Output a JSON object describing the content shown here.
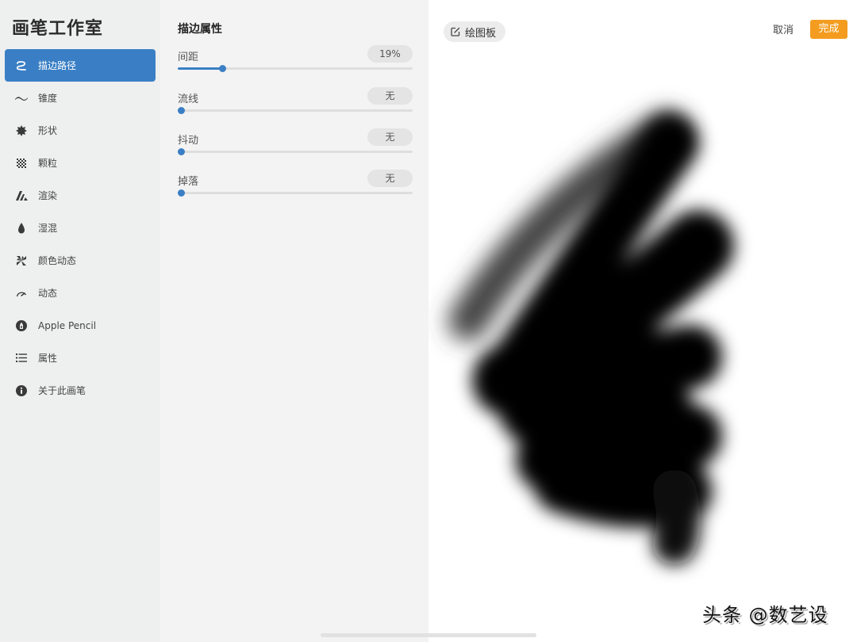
{
  "sidebar": {
    "title": "画笔工作室",
    "items": [
      {
        "label": "描边路径",
        "icon": "stroke-path-icon",
        "active": true
      },
      {
        "label": "锥度",
        "icon": "taper-icon",
        "active": false
      },
      {
        "label": "形状",
        "icon": "shape-icon",
        "active": false
      },
      {
        "label": "颗粒",
        "icon": "grain-icon",
        "active": false
      },
      {
        "label": "渲染",
        "icon": "rendering-icon",
        "active": false
      },
      {
        "label": "湿混",
        "icon": "wet-mix-icon",
        "active": false
      },
      {
        "label": "颜色动态",
        "icon": "color-dynamics-icon",
        "active": false
      },
      {
        "label": "动态",
        "icon": "dynamics-icon",
        "active": false
      },
      {
        "label": "Apple Pencil",
        "icon": "apple-pencil-icon",
        "active": false
      },
      {
        "label": "属性",
        "icon": "properties-list-icon",
        "active": false
      },
      {
        "label": "关于此画笔",
        "icon": "info-icon",
        "active": false
      }
    ]
  },
  "panel": {
    "title": "描边属性",
    "properties": [
      {
        "name": "间距",
        "value_label": "19%",
        "value": 0.19
      },
      {
        "name": "流线",
        "value_label": "无",
        "value": 0
      },
      {
        "name": "抖动",
        "value_label": "无",
        "value": 0
      },
      {
        "name": "掉落",
        "value_label": "无",
        "value": 0
      }
    ]
  },
  "canvas": {
    "drawing_pad_label": "绘图板",
    "cancel_label": "取消",
    "done_label": "完成",
    "watermark": "头条 @数艺设"
  },
  "colors": {
    "accent": "#3a7fc5",
    "done": "#f39c1f"
  }
}
